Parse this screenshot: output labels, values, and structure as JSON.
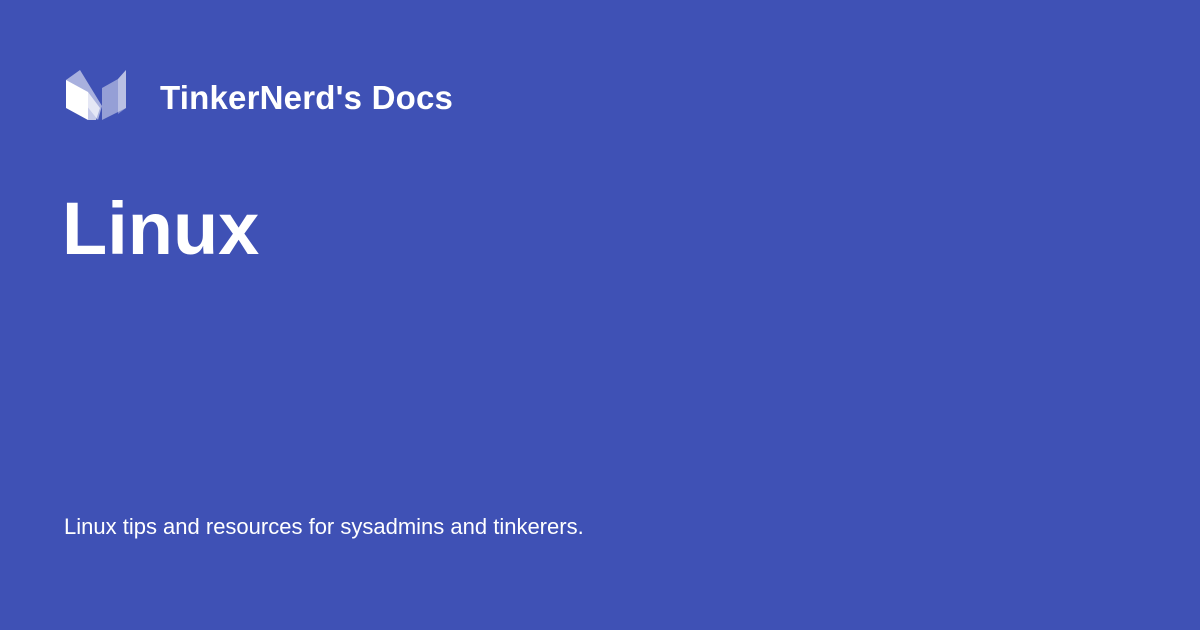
{
  "site": {
    "name": "TinkerNerd's Docs",
    "logo_icon": "material-m-logo-icon"
  },
  "page": {
    "title": "Linux",
    "description": "Linux tips and resources for sysadmins and tinkerers."
  },
  "colors": {
    "background": "#3f51b5",
    "text": "#ffffff"
  }
}
